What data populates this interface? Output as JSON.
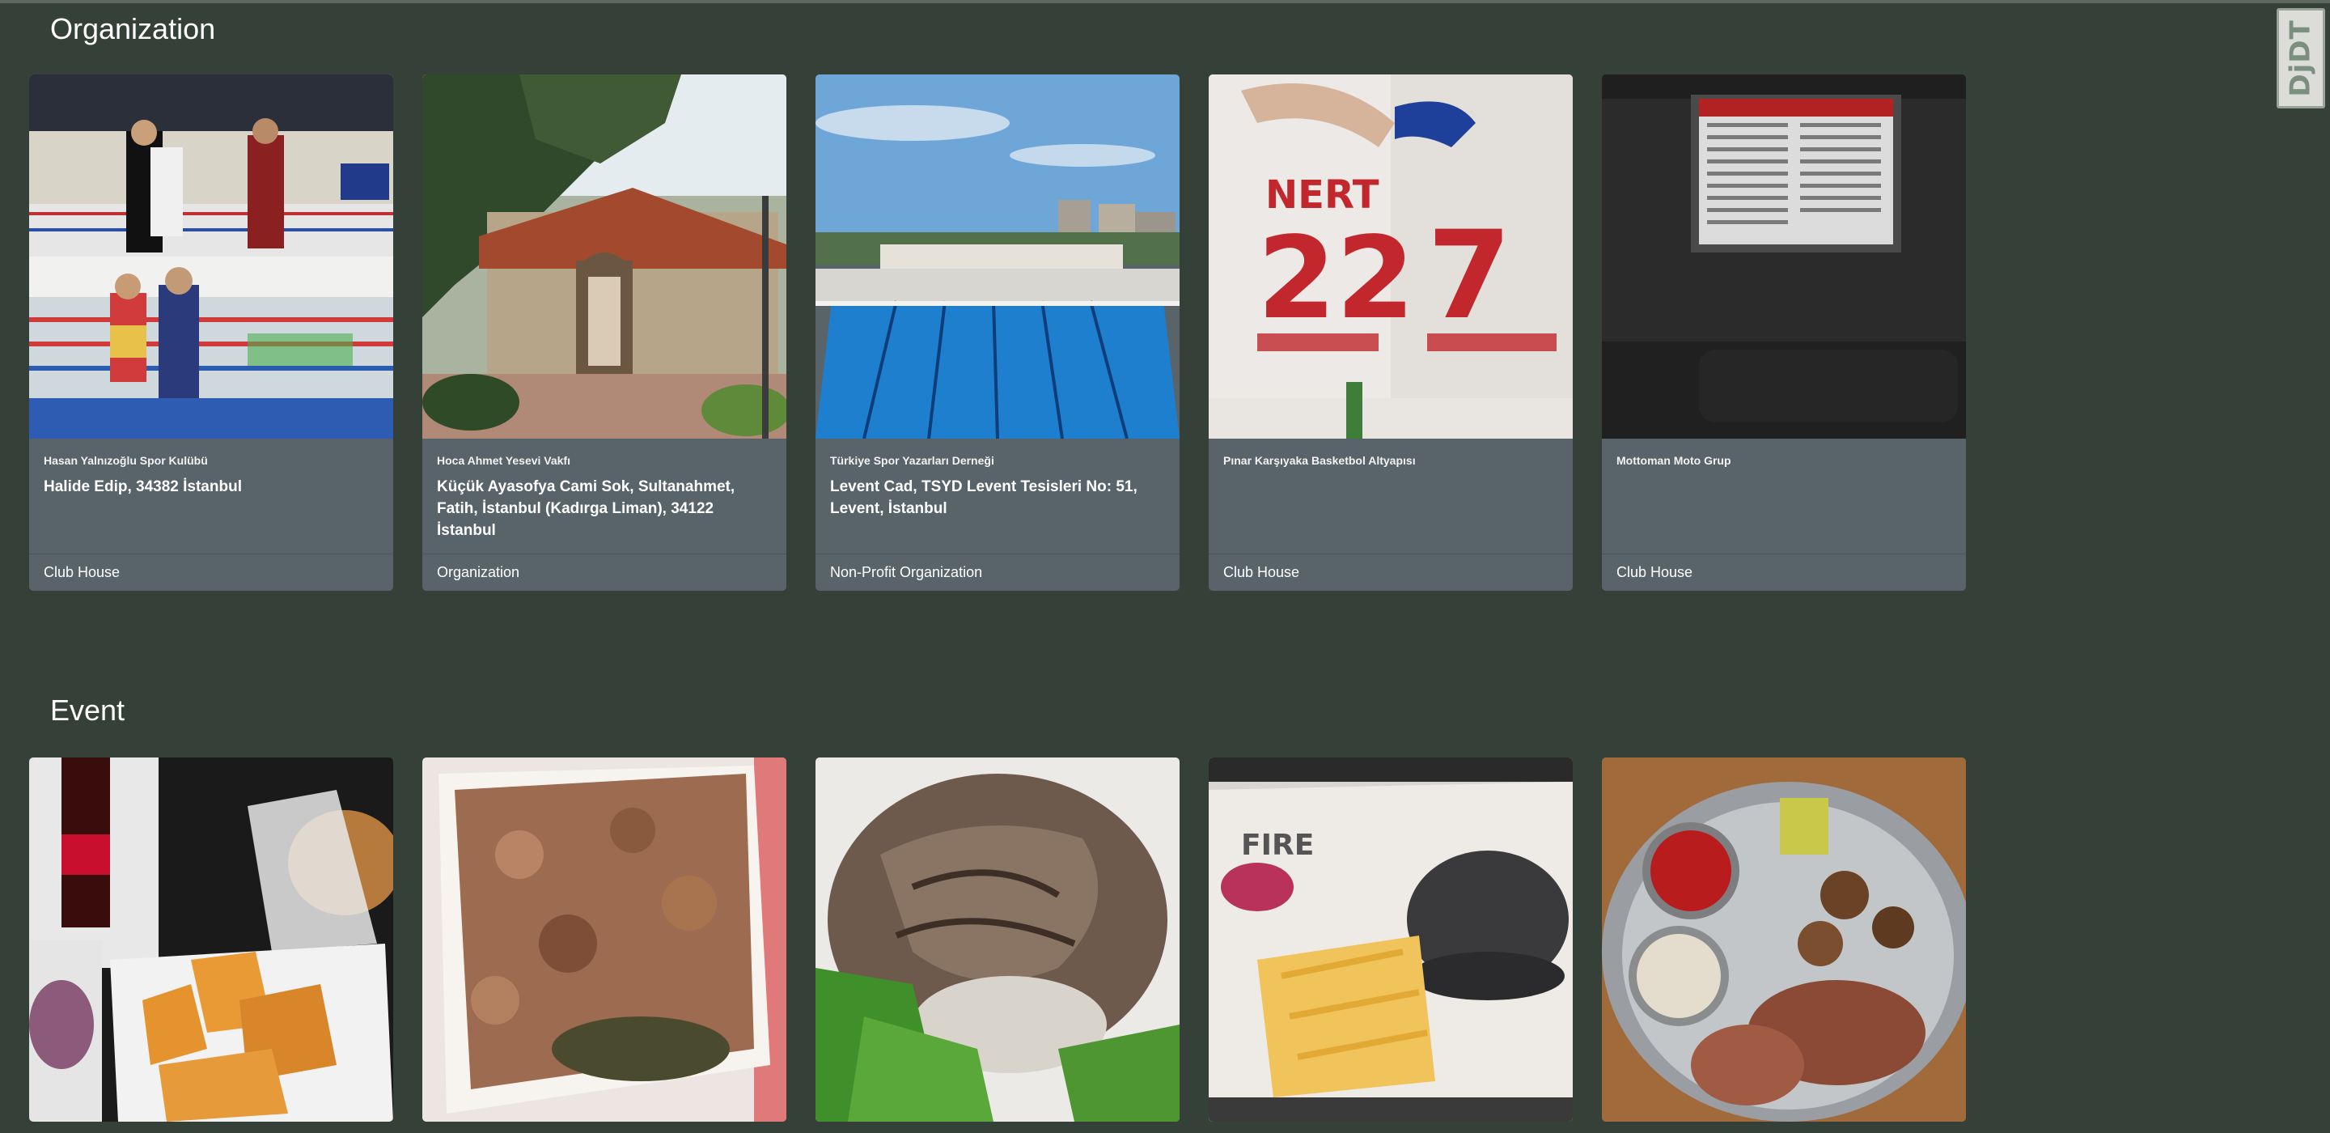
{
  "toolbar": {
    "label": "DjDT"
  },
  "colors": {
    "background": "#344038",
    "card": "#58646a",
    "text": "#ffffff"
  },
  "organization_section": {
    "title": "Organization",
    "cards": [
      {
        "org_name": "Hasan Yalnızoğlu Spor Kulübü",
        "address": "Halide Edip, 34382 İstanbul",
        "category": "Club House",
        "image": "boxing-ring-photo"
      },
      {
        "org_name": "Hoca Ahmet Yesevi Vakfı",
        "address": "Küçük Ayasofya Cami Sok, Sultanahmet, Fatih, İstanbul (Kadırga Liman), 34122 İstanbul",
        "category": "Organization",
        "image": "mosque-courtyard-photo"
      },
      {
        "org_name": "Türkiye Spor Yazarları Derneği",
        "address": "Levent Cad, TSYD Levent Tesisleri No: 51, Levent, İstanbul",
        "category": "Non-Profit Organization",
        "image": "swimming-pool-photo"
      },
      {
        "org_name": "Pınar Karşıyaka Basketbol Altyapısı",
        "address": "",
        "category": "Club House",
        "image": "jerseys-photo"
      },
      {
        "org_name": "Mottoman Moto Grup",
        "address": "",
        "category": "Club House",
        "image": "tv-lineup-photo"
      }
    ]
  },
  "event_section": {
    "title": "Event",
    "cards": [
      {
        "image": "burger-fries-cola-photo"
      },
      {
        "image": "grilled-meat-plate-photo"
      },
      {
        "image": "seafood-salad-photo"
      },
      {
        "image": "black-burger-fries-photo"
      },
      {
        "image": "meat-platter-photo"
      }
    ]
  }
}
